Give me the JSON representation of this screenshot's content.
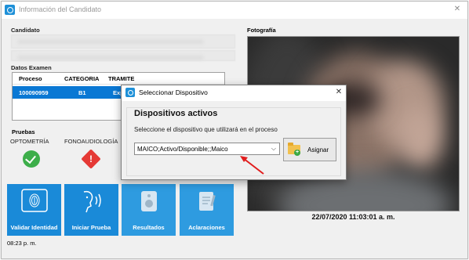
{
  "window": {
    "title": "Información del Candidato",
    "close_glyph": "✕"
  },
  "candidate": {
    "label": "Candidato"
  },
  "exam": {
    "label": "Datos Examen",
    "columns": [
      "Proceso",
      "CATEGORIA",
      "TRAMITE"
    ],
    "rows": [
      {
        "proceso": "100090959",
        "categoria": "B1",
        "tramite": "Exp"
      }
    ]
  },
  "tests": {
    "label": "Pruebas",
    "items": [
      {
        "name": "OPTOMETRÍA",
        "status": "passed",
        "icon": "check-circle-icon"
      },
      {
        "name": "FONOAUDIOLOGÍA",
        "status": "warning",
        "icon": "warning-icon"
      }
    ]
  },
  "tiles": [
    {
      "label": "Validar Identidad",
      "icon": "fingerprint-icon"
    },
    {
      "label": "Iniciar Prueba",
      "icon": "hearing-test-icon"
    },
    {
      "label": "Resultados",
      "icon": "speaker-icon"
    },
    {
      "label": "Aclaraciones",
      "icon": "notes-icon"
    }
  ],
  "status": {
    "time": "08:23 p. m."
  },
  "photo": {
    "label": "Fotografía",
    "timestamp": "22/07/2020 11:03:01 a. m."
  },
  "dialog": {
    "title": "Seleccionar Dispositivo",
    "close_glyph": "✕",
    "heading": "Dispositivos activos",
    "description": "Seleccione el dispositivo que utilizará en el proceso",
    "select_value": "MAICO;Activo/Disponible;;Maico",
    "select_arrow": "⌵",
    "assign_label": "Asignar",
    "assign_plus": "+"
  },
  "colors": {
    "accent": "#1a8ad8",
    "selection": "#0a78d4",
    "success": "#3dae4a",
    "warning": "#e53935",
    "annotation_arrow": "#e11d1d"
  }
}
